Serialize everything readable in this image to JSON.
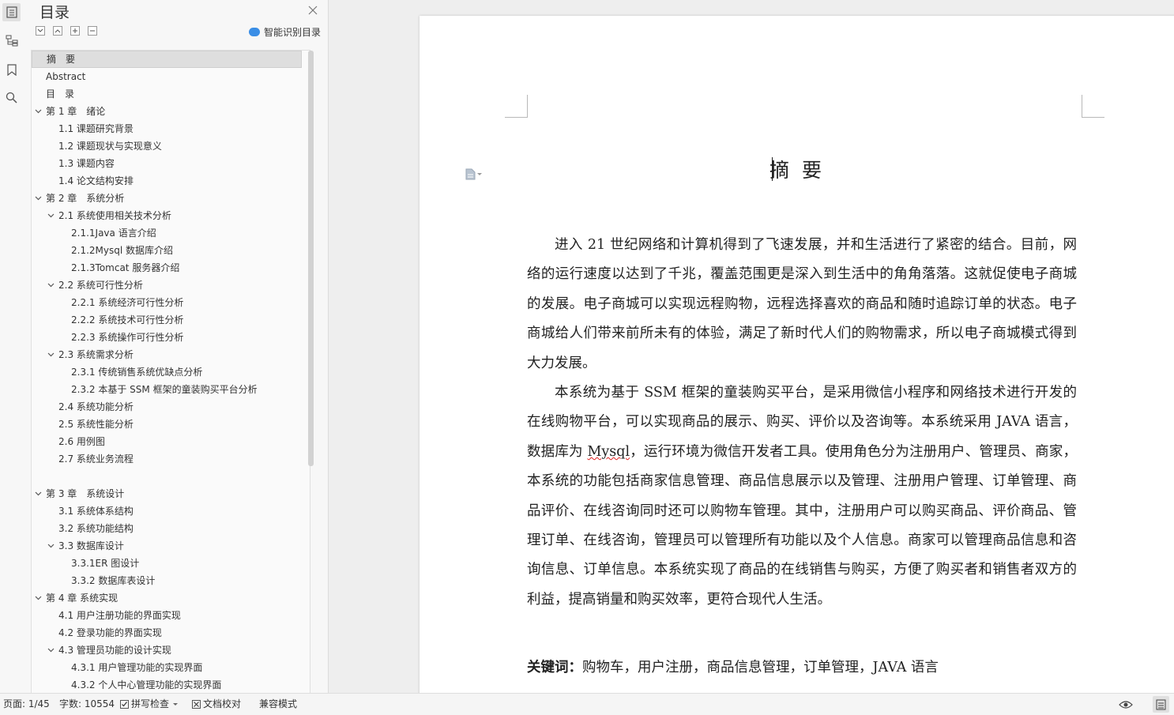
{
  "toc": {
    "title": "目录",
    "smart_label": "智能识别目录",
    "items": [
      {
        "label": "摘　要",
        "level": 1,
        "caret": false,
        "selected": true
      },
      {
        "label": "Abstract",
        "level": 1,
        "caret": false
      },
      {
        "label": "目　录",
        "level": 1,
        "caret": false
      },
      {
        "label": "第 1 章　绪论",
        "level": 1,
        "caret": true
      },
      {
        "label": "1.1 课题研究背景",
        "level": 2,
        "caret": false
      },
      {
        "label": "1.2 课题现状与实现意义",
        "level": 2,
        "caret": false
      },
      {
        "label": "1.3 课题内容",
        "level": 2,
        "caret": false
      },
      {
        "label": "1.4 论文结构安排",
        "level": 2,
        "caret": false
      },
      {
        "label": "第 2 章　系统分析",
        "level": 1,
        "caret": true
      },
      {
        "label": "2.1 系统使用相关技术分析",
        "level": 2,
        "caret": true
      },
      {
        "label": "2.1.1Java 语言介绍",
        "level": 3,
        "caret": false
      },
      {
        "label": "2.1.2Mysql 数据库介绍",
        "level": 3,
        "caret": false
      },
      {
        "label": "2.1.3Tomcat 服务器介绍",
        "level": 3,
        "caret": false
      },
      {
        "label": "2.2 系统可行性分析",
        "level": 2,
        "caret": true
      },
      {
        "label": "2.2.1 系统经济可行性分析",
        "level": 3,
        "caret": false
      },
      {
        "label": "2.2.2 系统技术可行性分析",
        "level": 3,
        "caret": false
      },
      {
        "label": "2.2.3 系统操作可行性分析",
        "level": 3,
        "caret": false
      },
      {
        "label": "2.3 系统需求分析",
        "level": 2,
        "caret": true
      },
      {
        "label": "2.3.1 传统销售系统优缺点分析",
        "level": 3,
        "caret": false
      },
      {
        "label": "2.3.2 本基于 SSM 框架的童装购买平台分析",
        "level": 3,
        "caret": false
      },
      {
        "label": "2.4 系统功能分析",
        "level": 2,
        "caret": false
      },
      {
        "label": "2.5 系统性能分析",
        "level": 2,
        "caret": false
      },
      {
        "label": "2.6 用例图",
        "level": 2,
        "caret": false
      },
      {
        "label": "2.7 系统业务流程",
        "level": 2,
        "caret": false
      },
      {
        "label": "",
        "level": 1,
        "caret": false
      },
      {
        "label": "第 3 章　系统设计",
        "level": 1,
        "caret": true
      },
      {
        "label": "3.1 系统体系结构",
        "level": 2,
        "caret": false
      },
      {
        "label": "3.2 系统功能结构",
        "level": 2,
        "caret": false
      },
      {
        "label": "3.3 数据库设计",
        "level": 2,
        "caret": true
      },
      {
        "label": "3.3.1ER 图设计",
        "level": 3,
        "caret": false
      },
      {
        "label": "3.3.2 数据库表设计",
        "level": 3,
        "caret": false
      },
      {
        "label": "第 4 章 系统实现",
        "level": 1,
        "caret": true
      },
      {
        "label": "4.1 用户注册功能的界面实现",
        "level": 2,
        "caret": false
      },
      {
        "label": "4.2 登录功能的界面实现",
        "level": 2,
        "caret": false
      },
      {
        "label": "4.3 管理员功能的设计实现",
        "level": 2,
        "caret": true
      },
      {
        "label": "4.3.1 用户管理功能的实现界面",
        "level": 3,
        "caret": false
      },
      {
        "label": "4.3.2 个人中心管理功能的实现界面",
        "level": 3,
        "caret": false
      }
    ]
  },
  "document": {
    "title": "摘要",
    "paragraph1": "进入 21 世纪网络和计算机得到了飞速发展，并和生活进行了紧密的结合。目前，网络的运行速度以达到了千兆，覆盖范围更是深入到生活中的角角落落。这就促使电子商城的发展。电子商城可以实现远程购物，远程选择喜欢的商品和随时追踪订单的状态。电子商城给人们带来前所未有的体验，满足了新时代人们的购物需求，所以电子商城模式得到大力发展。",
    "paragraph2_a": "本系统为基于 SSM 框架的童装购买平台，是采用微信小程序和网络技术进行开发的在线购物平台，可以实现商品的展示、购买、评价以及咨询等。本系统采用 JAVA 语言，数据库为 ",
    "paragraph2_word": "Mysql",
    "paragraph2_b": "，运行环境为微信开发者工具。使用角色分为注册用户、管理员、商家，本系统的功能包括商家信息管理、商品信息展示以及管理、注册用户管理、订单管理、商品评价、在线咨询同时还可以购物车管理。其中，注册用户可以购买商品、评价商品、管理订单、在线咨询，管理员可以管理所有功能以及个人信息。商家可以管理商品信息和咨询信息、订单信息。本系统实现了商品的在线销售与购买，方便了购买者和销售者双方的利益，提高销量和购买效率，更符合现代人生活。",
    "keywords_label": "关键词：",
    "keywords": "购物车，用户注册，商品信息管理，订单管理，JAVA 语言"
  },
  "status": {
    "page": "页面: 1/45",
    "words": "字数: 10554",
    "spell": "拼写检查",
    "proof": "文档校对",
    "compat": "兼容模式"
  }
}
